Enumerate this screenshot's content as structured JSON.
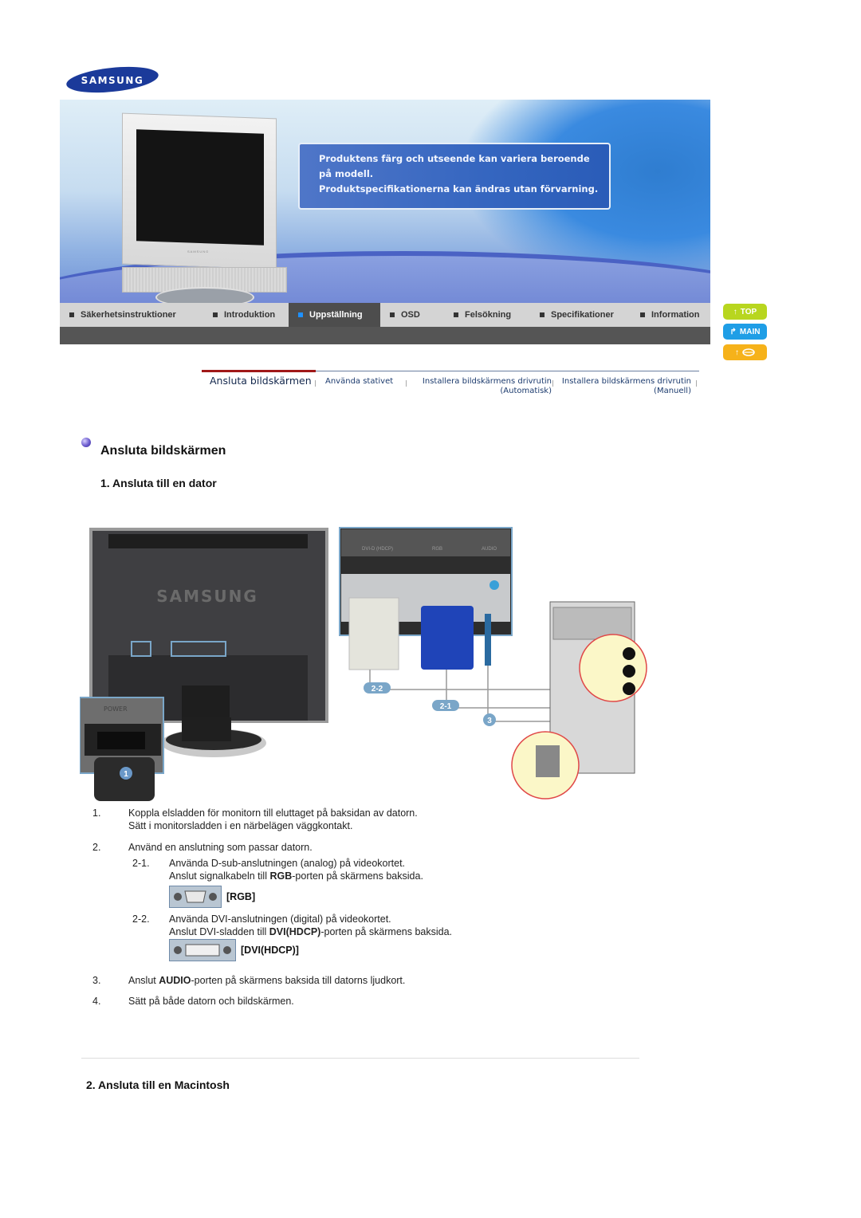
{
  "header": {
    "logo_text": "SAMSUNG",
    "banner_notice": [
      "Produktens färg och utseende kan variera beroende",
      "på modell.",
      "Produktspecifikationerna kan ändras utan förvarning."
    ],
    "monitor_brand": "SAMSUNG"
  },
  "nav": {
    "items": [
      {
        "label": "Säkerhetsinstruktioner",
        "active": false
      },
      {
        "label": "Introduktion",
        "active": false
      },
      {
        "label": "Uppställning",
        "active": true
      },
      {
        "label": "OSD",
        "active": false
      },
      {
        "label": "Felsökning",
        "active": false
      },
      {
        "label": "Specifikationer",
        "active": false
      },
      {
        "label": "Information",
        "active": false
      }
    ]
  },
  "side_buttons": {
    "top": {
      "label": "TOP",
      "color": "#b8d61f"
    },
    "main": {
      "label": "MAIN",
      "color": "#1f9ee6"
    },
    "back": {
      "label": "",
      "color": "#f6b21a"
    }
  },
  "subtabs": {
    "items": [
      {
        "line1": "Ansluta bildskärmen",
        "line2": "",
        "active": true
      },
      {
        "line1": "Använda stativet",
        "line2": "",
        "active": false
      },
      {
        "line1": "Installera bildskärmens drivrutin",
        "line2": "(Automatisk)",
        "active": false
      },
      {
        "line1": "Installera bildskärmens drivrutin",
        "line2": "(Manuell)",
        "active": false
      }
    ]
  },
  "content": {
    "title": "Ansluta bildskärmen",
    "section1_title": "1. Ansluta till en dator",
    "figure": {
      "callouts": [
        "1",
        "2-2",
        "2-1",
        "3"
      ],
      "panel_labels": [
        "DVI-D (HDCP)",
        "RGB",
        "AUDIO"
      ],
      "inset_label": "POWER",
      "rear_brand": "SAMSUNG"
    },
    "steps": [
      {
        "num": "1.",
        "lines": [
          "Koppla elsladden för monitorn till eluttaget på baksidan av datorn.",
          "Sätt i monitorsladden i en närbelägen väggkontakt."
        ]
      },
      {
        "num": "2.",
        "lines": [
          "Använd en anslutning som passar datorn."
        ]
      },
      {
        "num": "3.",
        "pre": "Anslut ",
        "bold": "AUDIO",
        "post": "-porten på skärmens baksida till datorns ljudkort."
      },
      {
        "num": "4.",
        "lines": [
          "Sätt på både datorn och bildskärmen."
        ]
      }
    ],
    "substeps": [
      {
        "num": "2-1.",
        "line1": "Använda D-sub-anslutningen (analog) på videokortet.",
        "line2_pre": "Anslut signalkabeln till ",
        "line2_bold": "RGB",
        "line2_post": "-porten på skärmens baksida.",
        "port_label": "[RGB]"
      },
      {
        "num": "2-2.",
        "line1": "Använda DVI-anslutningen (digital) på videokortet.",
        "line2_pre": "Anslut DVI-sladden till ",
        "line2_bold": "DVI(HDCP)",
        "line2_post": "-porten på skärmens baksida.",
        "port_label": "[DVI(HDCP)]"
      }
    ],
    "section2_title": "2. Ansluta till en Macintosh"
  }
}
